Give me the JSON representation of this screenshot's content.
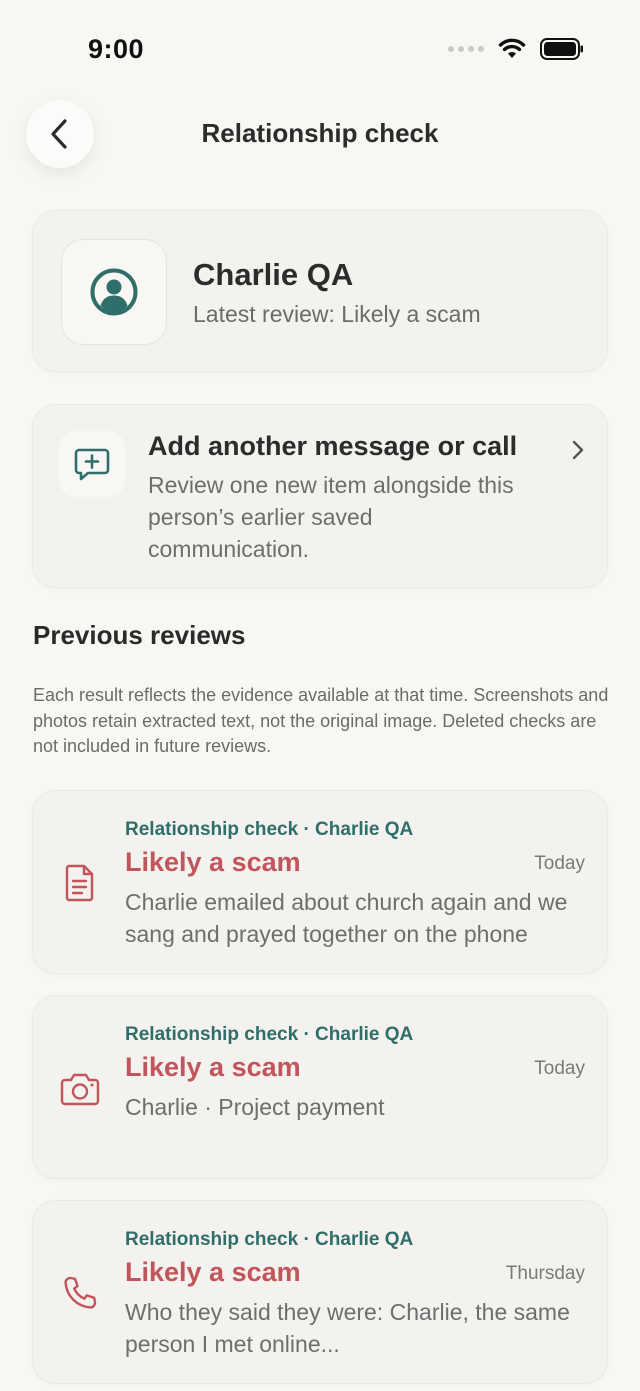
{
  "status_bar": {
    "time": "9:00"
  },
  "header": {
    "title": "Relationship check"
  },
  "contact": {
    "name": "Charlie QA",
    "subtitle": "Latest review: Likely a scam"
  },
  "add_item": {
    "title": "Add another message or call",
    "description": "Review one new item alongside this person’s earlier saved communication."
  },
  "previous_reviews": {
    "title": "Previous reviews",
    "note": "Each result reflects the evidence available at that time. Screenshots and photos retain extracted text, not the original image. Deleted checks are not included in future reviews.",
    "items": [
      {
        "kicker": "Relationship check · Charlie QA",
        "verdict": "Likely a scam",
        "date": "Today",
        "snippet": "Charlie emailed about church again and we sang and prayed together on the phone",
        "icon": "document-icon"
      },
      {
        "kicker": "Relationship check · Charlie QA",
        "verdict": "Likely a scam",
        "date": "Today",
        "snippet": "Charlie · Project payment",
        "icon": "camera-icon"
      },
      {
        "kicker": "Relationship check · Charlie QA",
        "verdict": "Likely a scam",
        "date": "Thursday",
        "snippet": "Who they said they were: Charlie, the same person I met online...",
        "icon": "phone-icon"
      }
    ]
  },
  "colors": {
    "background": "#f8f7f4",
    "card": "#f3f2ef",
    "accent_teal": "#2f6e69",
    "danger": "#c2555b"
  }
}
